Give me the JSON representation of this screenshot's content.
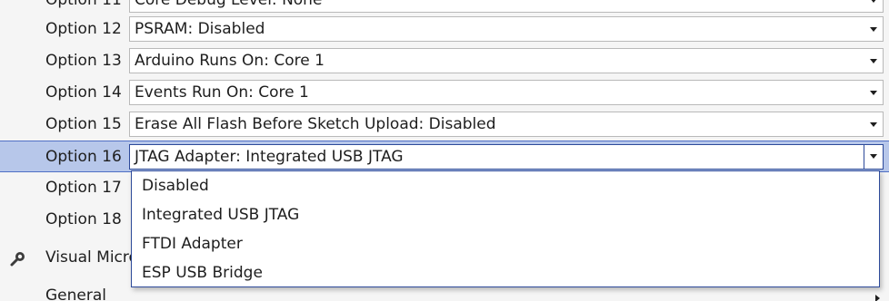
{
  "properties": [
    {
      "name": "Option 11",
      "value": "Core Debug Level: None"
    },
    {
      "name": "Option 12",
      "value": "PSRAM: Disabled"
    },
    {
      "name": "Option 13",
      "value": "Arduino Runs On: Core 1"
    },
    {
      "name": "Option 14",
      "value": "Events Run On: Core 1"
    },
    {
      "name": "Option 15",
      "value": "Erase All Flash Before Sketch Upload: Disabled"
    },
    {
      "name": "Option 16",
      "value": "JTAG Adapter: Integrated USB JTAG"
    },
    {
      "name": "Option 17",
      "value": ""
    },
    {
      "name": "Option 18",
      "value": ""
    }
  ],
  "categories": [
    {
      "name": "Visual Micro"
    },
    {
      "name": "General"
    }
  ],
  "dropdown": {
    "options": [
      "Disabled",
      "Integrated USB JTAG",
      "FTDI Adapter",
      "ESP USB Bridge"
    ]
  },
  "icons": {
    "category": "wrench-icon",
    "dropdown": "chevron-down-icon",
    "expand": "chevron-right-icon"
  },
  "colors": {
    "selection": "#b7c7ea",
    "selection_border": "#2d4a9a"
  }
}
